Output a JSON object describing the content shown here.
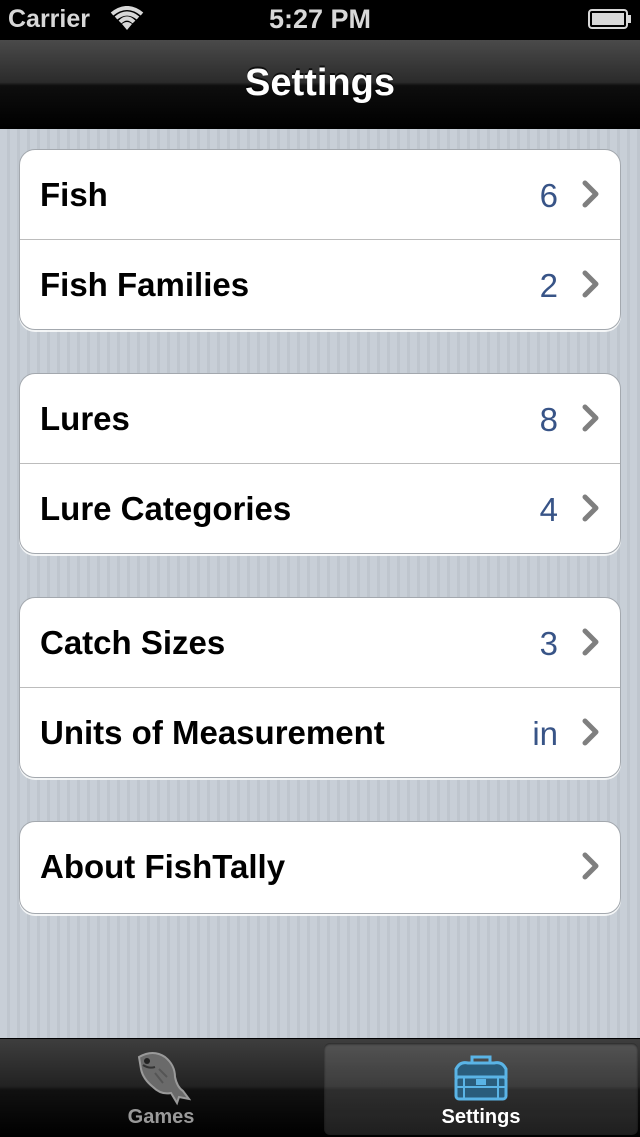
{
  "status_bar": {
    "carrier": "Carrier",
    "time": "5:27 PM"
  },
  "nav": {
    "title": "Settings"
  },
  "groups": [
    {
      "rows": [
        {
          "label": "Fish",
          "value": "6"
        },
        {
          "label": "Fish Families",
          "value": "2"
        }
      ]
    },
    {
      "rows": [
        {
          "label": "Lures",
          "value": "8"
        },
        {
          "label": "Lure Categories",
          "value": "4"
        }
      ]
    },
    {
      "rows": [
        {
          "label": "Catch Sizes",
          "value": "3"
        },
        {
          "label": "Units of Measurement",
          "value": "in"
        }
      ]
    },
    {
      "rows": [
        {
          "label": "About FishTally",
          "value": ""
        }
      ]
    }
  ],
  "tabs": [
    {
      "label": "Games",
      "icon": "fish-icon",
      "selected": false
    },
    {
      "label": "Settings",
      "icon": "tackle-box-icon",
      "selected": true
    }
  ],
  "colors": {
    "value_text": "#385487",
    "selected_tab_icon": "#5ab4e6"
  }
}
